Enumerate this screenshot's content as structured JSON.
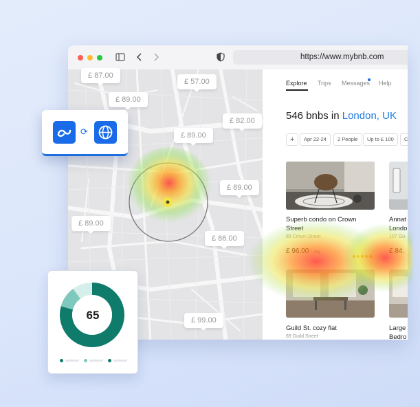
{
  "browser": {
    "url": "https://www.mybnb.com",
    "traffic_colors": [
      "#ff5f57",
      "#febc2e",
      "#28c840"
    ],
    "icons": [
      "sidebar-icon",
      "back-icon",
      "forward-icon",
      "shield-icon"
    ]
  },
  "map": {
    "prices": [
      "£ 87.00",
      "£ 57.00",
      "£ 89.00",
      "£ 82.00",
      "£ 89.00",
      "£ 89.00",
      "£ 89.00",
      "£ 86.00",
      "£ 99.00"
    ]
  },
  "panel": {
    "tabs": [
      "Explore",
      "Trips",
      "Messages",
      "Help"
    ],
    "active_tab": "Explore",
    "title_prefix": "546 bnbs in ",
    "title_location": "London, UK",
    "filters": {
      "add_icon": "+",
      "chips": [
        "Apr 22-24",
        "2 People",
        "Up to £ 100",
        "C"
      ]
    },
    "listings": [
      {
        "title": "Superb condo on Crown Street",
        "address": "89  Crown Street",
        "price": "£ 96.00",
        "per": "/ day"
      },
      {
        "title": "Annat Londo",
        "address": "107  Gu",
        "price": "£ 84."
      },
      {
        "title": "Guild St. cozy flat",
        "address": "89  Guild Street"
      },
      {
        "title": "Large Bedro"
      }
    ],
    "accent": "#1f7be0"
  },
  "integration": {
    "icons": [
      "link-logo-icon",
      "sync-icon",
      "globe-icon"
    ],
    "accent": "#1a6be8"
  },
  "score": {
    "value": "65",
    "colors": [
      "#0e7b6b",
      "#7fc8bd",
      "#d5efec"
    ]
  }
}
